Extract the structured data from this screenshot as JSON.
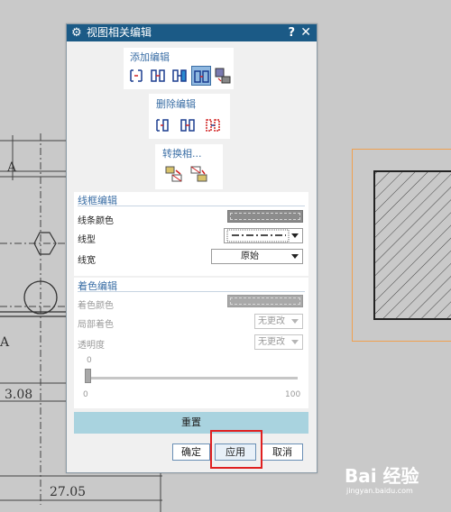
{
  "drawing": {
    "labels": [
      "A",
      "A",
      "3.08",
      "27.05"
    ]
  },
  "dialog": {
    "title": "视图相关编辑",
    "help": "?",
    "close": "✕",
    "add_edit": {
      "label": "添加编辑",
      "icons": [
        "erase-object-icon",
        "edit-object-segment-icon",
        "edit-clip-icon",
        "edit-view-object-icon",
        "edit-section-icon"
      ],
      "active_index": 3
    },
    "delete_edit": {
      "label": "删除编辑",
      "icons": [
        "delete-selected-icon",
        "delete-all-icon",
        "delete-view-icon"
      ]
    },
    "convert": {
      "label": "转换相...",
      "icons": [
        "model-to-view-icon",
        "view-to-model-icon"
      ]
    },
    "wireframe": {
      "title": "线框编辑",
      "line_color_label": "线条颜色",
      "line_type_label": "线型",
      "line_width_label": "线宽",
      "line_width_value": "原始"
    },
    "shading": {
      "title": "着色编辑",
      "color_label": "着色颜色",
      "partial_label": "局部着色",
      "partial_value": "无更改",
      "transparency_label": "透明度",
      "transparency_value": "无更改",
      "slider_value": "0",
      "slider_min": "0",
      "slider_max": "100"
    },
    "reset_label": "重置",
    "ok_label": "确定",
    "apply_label": "应用",
    "cancel_label": "取消"
  },
  "watermark": {
    "brand": "Bai 经验",
    "url": "jingyan.baidu.com"
  }
}
